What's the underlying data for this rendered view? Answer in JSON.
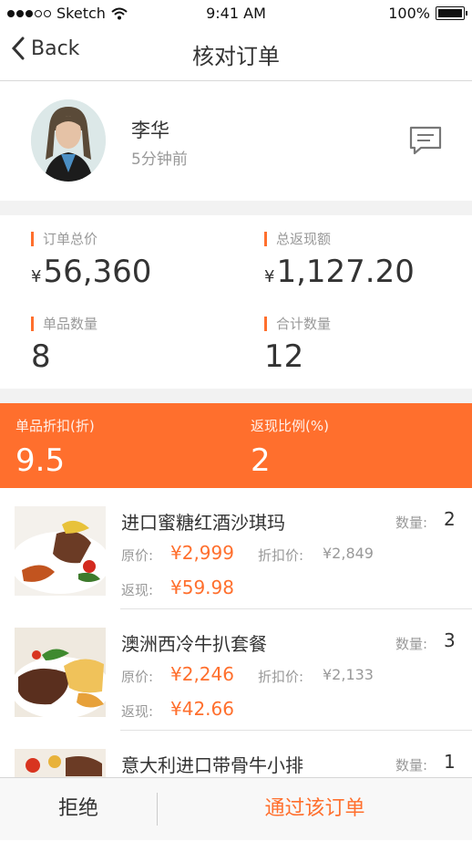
{
  "status_bar": {
    "carrier": "Sketch",
    "time": "9:41 AM",
    "battery": "100%"
  },
  "nav": {
    "back_label": "Back",
    "title": "核对订单"
  },
  "profile": {
    "name": "李华",
    "time_ago": "5分钟前"
  },
  "stats": {
    "order_total_label": "订单总价",
    "order_total_currency": "¥",
    "order_total_value": "56,360",
    "cashback_total_label": "总返现额",
    "cashback_total_currency": "¥",
    "cashback_total_value": "1,127.20",
    "item_count_label": "单品数量",
    "item_count_value": "8",
    "total_qty_label": "合计数量",
    "total_qty_value": "12"
  },
  "band": {
    "discount_label": "单品折扣(折)",
    "discount_value": "9.5",
    "ratio_label": "返现比例(%)",
    "ratio_value": "2"
  },
  "labels": {
    "qty": "数量:",
    "orig": "原价:",
    "disc": "折扣价:",
    "cash": "返现:"
  },
  "products": [
    {
      "name": "进口蜜糖红酒沙琪玛",
      "qty": "2",
      "orig_price": "¥2,999",
      "disc_price": "¥2,849",
      "cashback": "¥59.98"
    },
    {
      "name": "澳洲西冷牛扒套餐",
      "qty": "3",
      "orig_price": "¥2,246",
      "disc_price": "¥2,133",
      "cashback": "¥42.66"
    },
    {
      "name": "意大利进口带骨牛小排",
      "qty": "1"
    }
  ],
  "actions": {
    "reject": "拒绝",
    "approve": "通过该订单"
  },
  "colors": {
    "accent": "#ff6f2d"
  }
}
